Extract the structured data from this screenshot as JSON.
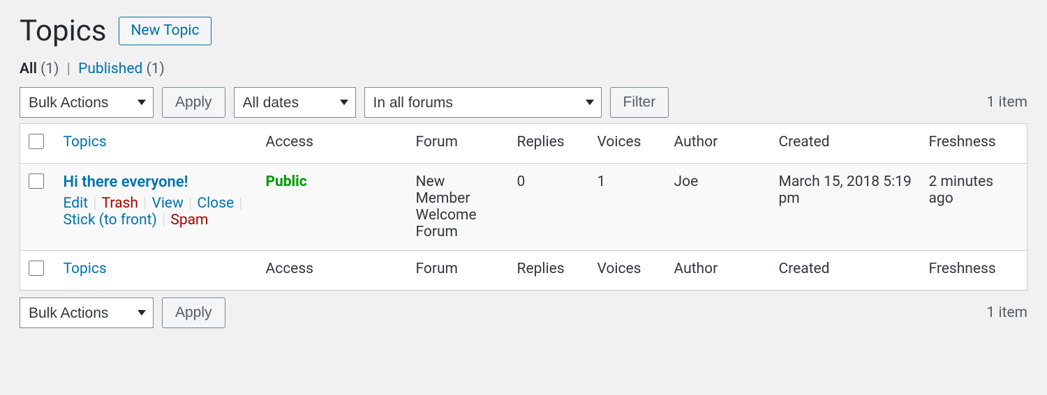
{
  "header": {
    "title": "Topics",
    "new_button": "New Topic"
  },
  "filters": {
    "all_label": "All",
    "all_count": "(1)",
    "separator": "|",
    "published_label": "Published",
    "published_count": "(1)"
  },
  "tablenav": {
    "bulk_actions": "Bulk Actions",
    "apply": "Apply",
    "all_dates": "All dates",
    "in_all_forums": "In all forums",
    "filter": "Filter",
    "item_count": "1 item"
  },
  "columns": {
    "topics": "Topics",
    "access": "Access",
    "forum": "Forum",
    "replies": "Replies",
    "voices": "Voices",
    "author": "Author",
    "created": "Created",
    "freshness": "Freshness"
  },
  "rows": [
    {
      "title": "Hi there everyone!",
      "actions": {
        "edit": "Edit",
        "trash": "Trash",
        "view": "View",
        "close": "Close",
        "stick": "Stick (to front)",
        "spam": "Spam"
      },
      "access": "Public",
      "forum": "New Member Welcome Forum",
      "replies": "0",
      "voices": "1",
      "author": "Joe",
      "created": "March 15, 2018 5:19 pm",
      "freshness": "2 minutes ago"
    }
  ]
}
